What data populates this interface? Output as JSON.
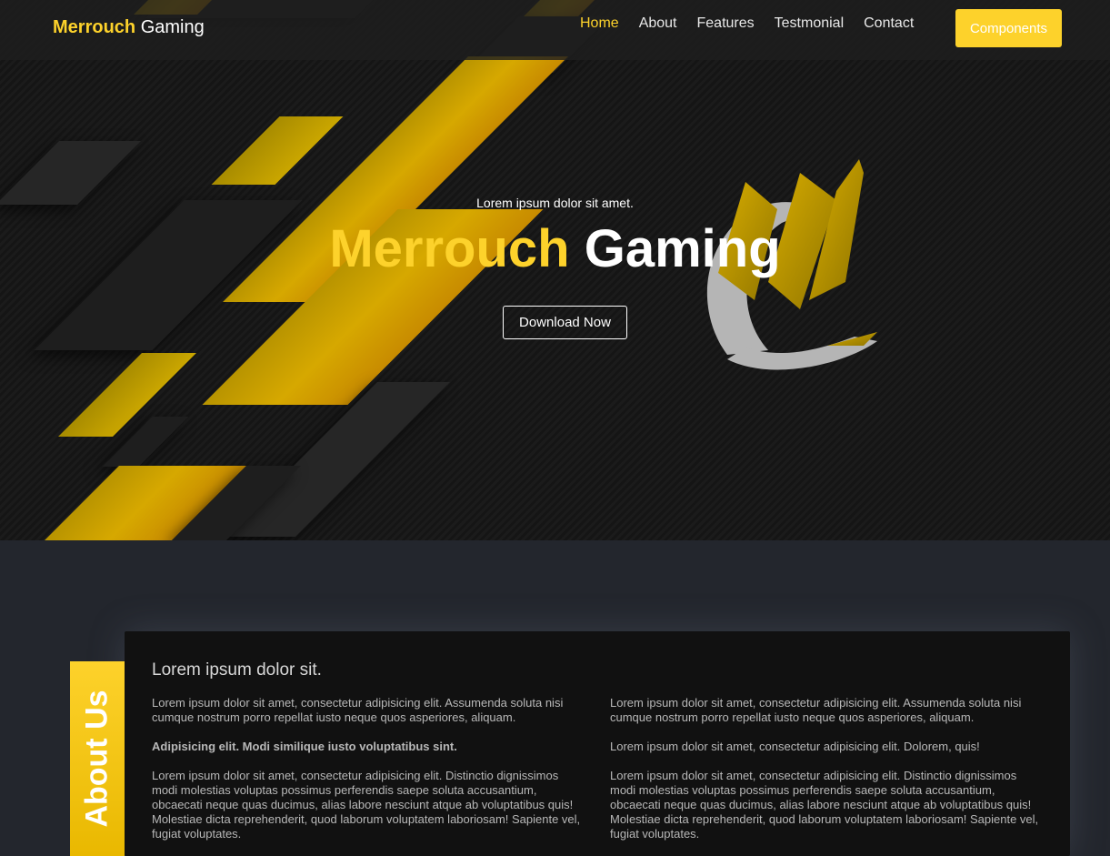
{
  "brand": {
    "part1": "Merrouch",
    "part2": "Gaming"
  },
  "nav": {
    "items": [
      {
        "label": "Home",
        "active": true
      },
      {
        "label": "About",
        "active": false
      },
      {
        "label": "Features",
        "active": false
      },
      {
        "label": "Testmonial",
        "active": false
      },
      {
        "label": "Contact",
        "active": false
      }
    ],
    "cta_label": "Components"
  },
  "hero": {
    "subtitle": "Lorem ipsum dolor sit amet.",
    "title_part1": "Merrouch",
    "title_part2": "Gaming",
    "button_label": "Download Now"
  },
  "about": {
    "tab_label": "About Us",
    "heading": "Lorem ipsum dolor sit.",
    "left": [
      {
        "text": "Lorem ipsum dolor sit amet, consectetur adipisicing elit. Assumenda soluta nisi cumque nostrum porro repellat iusto neque quos asperiores, aliquam."
      },
      {
        "text": "Adipisicing elit. Modi similique iusto voluptatibus sint."
      },
      {
        "text": "Lorem ipsum dolor sit amet, consectetur adipisicing elit. Distinctio dignissimos modi molestias voluptas possimus perferendis saepe soluta accusantium, obcaecati neque quas ducimus, alias labore nesciunt atque ab voluptatibus quis! Molestiae dicta reprehenderit, quod laborum voluptatem laboriosam! Sapiente vel, fugiat voluptates."
      }
    ],
    "right": [
      {
        "text": "Lorem ipsum dolor sit amet, consectetur adipisicing elit. Assumenda soluta nisi cumque nostrum porro repellat iusto neque quos asperiores, aliquam."
      },
      {
        "text": "Lorem ipsum dolor sit amet, consectetur adipisicing elit. Dolorem, quis!"
      },
      {
        "text": "Lorem ipsum dolor sit amet, consectetur adipisicing elit. Distinctio dignissimos modi molestias voluptas possimus perferendis saepe soluta accusantium, obcaecati neque quas ducimus, alias labore nesciunt atque ab voluptatibus quis! Molestiae dicta reprehenderit, quod laborum voluptatem laboriosam! Sapiente vel, fugiat voluptates."
      }
    ]
  },
  "colors": {
    "accent": "#fdd22b",
    "background": "#23262d",
    "card": "#111111"
  },
  "icons": {
    "logo": "claw-logo-icon"
  }
}
